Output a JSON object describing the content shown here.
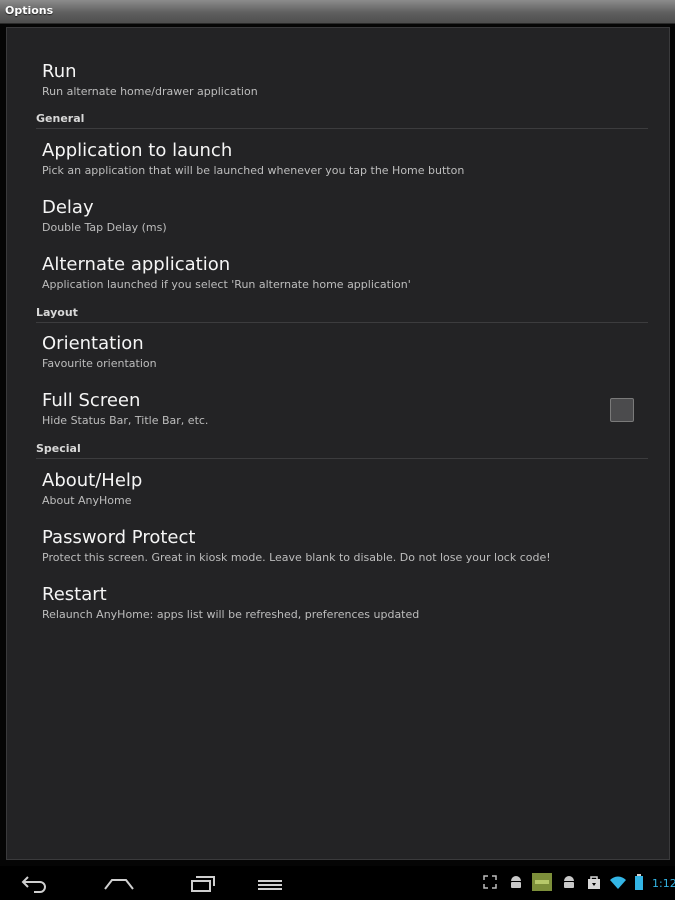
{
  "window": {
    "title": "Options"
  },
  "sections": {
    "run": {
      "title": "Run",
      "summary": "Run alternate home/drawer application"
    },
    "general": {
      "header": "General",
      "app_to_launch": {
        "title": "Application to launch",
        "summary": "Pick an application that will be launched whenever you tap the Home button"
      },
      "delay": {
        "title": "Delay",
        "summary": "Double Tap Delay (ms)"
      },
      "alternate": {
        "title": "Alternate application",
        "summary": "Application launched if you select 'Run alternate home application'"
      }
    },
    "layout": {
      "header": "Layout",
      "orientation": {
        "title": "Orientation",
        "summary": "Favourite orientation"
      },
      "fullscreen": {
        "title": "Full Screen",
        "summary": "Hide Status Bar, Title Bar, etc.",
        "checked": false
      }
    },
    "special": {
      "header": "Special",
      "about": {
        "title": "About/Help",
        "summary": "About AnyHome"
      },
      "password": {
        "title": "Password Protect",
        "summary": "Protect this screen. Great in kiosk mode. Leave blank to disable. Do not lose your lock code!"
      },
      "restart": {
        "title": "Restart",
        "summary": "Relaunch AnyHome: apps list will be refreshed, preferences updated"
      }
    }
  },
  "navbar": {
    "buttons": [
      "back-icon",
      "home-icon",
      "recent-apps-icon",
      "menu-icon"
    ],
    "tray_icons": [
      "fullscreen-icon",
      "android-icon",
      "app-icon",
      "android-icon",
      "bag-icon",
      "wifi-icon",
      "battery-icon"
    ],
    "clock": "1:12",
    "accent": "#33b5e5"
  }
}
